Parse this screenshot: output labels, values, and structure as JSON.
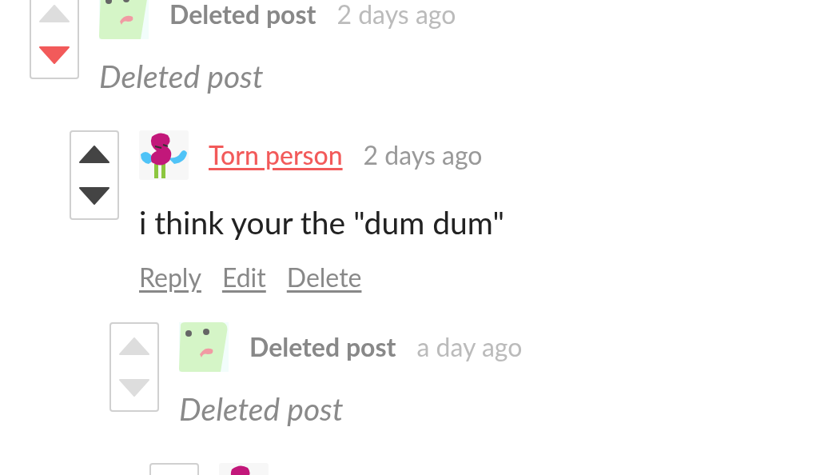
{
  "comments": [
    {
      "deleted": true,
      "author": "Deleted post",
      "time": "2 days ago",
      "body": "Deleted post",
      "avatar": {
        "kind": "frog"
      },
      "upvoted": false,
      "downvoted": true,
      "children": [
        {
          "deleted": false,
          "author": "Torn person",
          "time": "2 days ago",
          "body": "i think your the \"dum dum\"",
          "avatar": {
            "kind": "monster"
          },
          "upvoted": false,
          "downvoted": false,
          "actions": [
            "Reply",
            "Edit",
            "Delete"
          ],
          "children": [
            {
              "deleted": true,
              "author": "Deleted post",
              "time": "a day ago",
              "body": "Deleted post",
              "avatar": {
                "kind": "frog"
              },
              "upvoted": false,
              "downvoted": false,
              "children": [
                {
                  "avatar": {
                    "kind": "monster"
                  }
                }
              ]
            }
          ]
        }
      ]
    }
  ]
}
